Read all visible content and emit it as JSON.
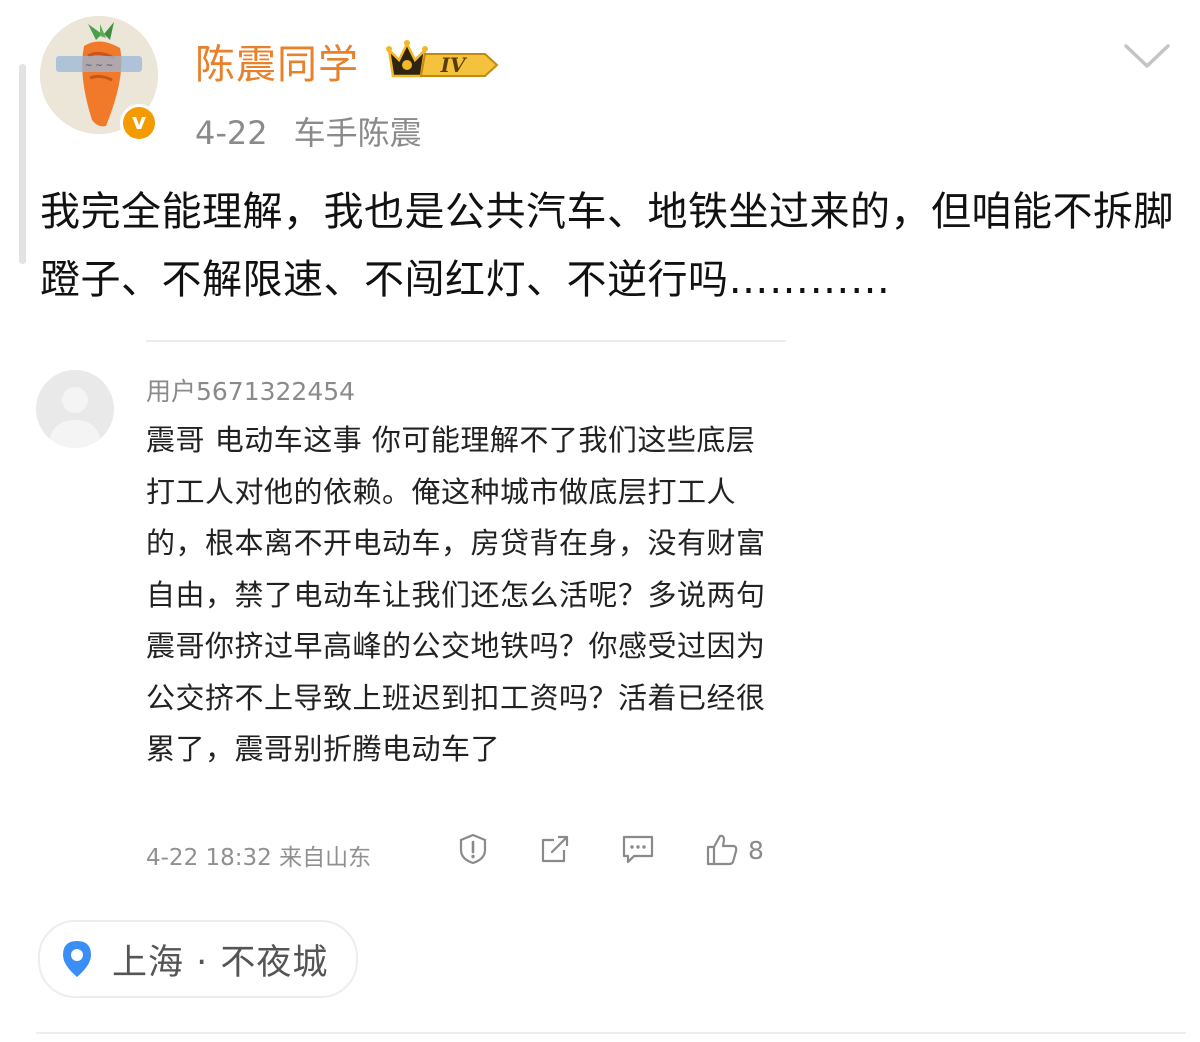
{
  "post": {
    "author_name": "陈震同学",
    "level_badge": "IV",
    "date": "4-22",
    "source": "车手陈震",
    "content": "我完全能理解，我也是公共汽车、地铁坐过来的，但咱能不拆脚蹬子、不解限速、不闯红灯、不逆行吗…………"
  },
  "quoted_comment": {
    "username": "用户5671322454",
    "content": "震哥 电动车这事 你可能理解不了我们这些底层打工人对他的依赖。俺这种城市做底层打工人的，根本离不开电动车，房贷背在身，没有财富自由，禁了电动车让我们还怎么活呢？多说两句震哥你挤过早高峰的公交地铁吗？你感受过因为公交挤不上导致上班迟到扣工资吗？活着已经很累了，震哥别折腾电动车了",
    "time": "4-22 18:32",
    "location": "来自山东",
    "like_count": "8",
    "actions": [
      "report-icon",
      "share-icon",
      "comment-icon",
      "like-icon"
    ]
  },
  "location_tag": {
    "text": "上海 · 不夜城",
    "icon": "location-pin-icon"
  },
  "colors": {
    "author_name": "#e8812b",
    "verified_badge": "#f39b00",
    "location_pin": "#3a8ef6",
    "meta_gray": "#8a8a8a"
  }
}
